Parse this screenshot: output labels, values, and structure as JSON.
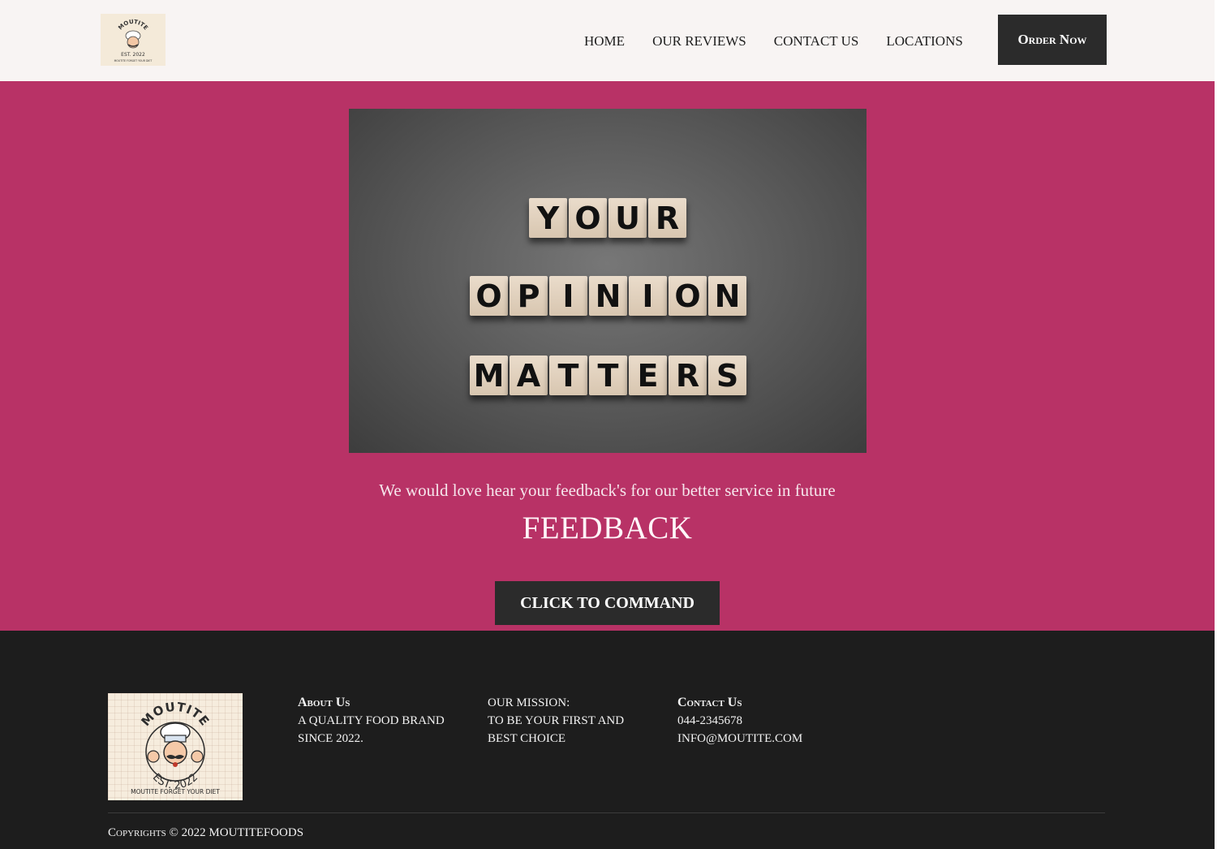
{
  "header": {
    "logo": {
      "alt": "Moutite logo",
      "ring_text": "MOUTITE",
      "est": "EST. 2022",
      "tagline": "MOUTITE FORGET YOUR DIET"
    },
    "nav": [
      "HOME",
      "OUR REVIEWS",
      "CONTACT US",
      "LOCATIONS"
    ],
    "order_button": "Order Now"
  },
  "hero": {
    "image_words": [
      "YOUR",
      "OPINION",
      "MATTERS"
    ],
    "subtitle": "We would love hear your feedback's for our better service in future",
    "title": "FEEDBACK",
    "cta_button": "CLICK TO COMMAND"
  },
  "footer": {
    "logo": {
      "ring_text": "MOUTITE",
      "est": "EST. 2022",
      "tagline": "MOUTITE FORGET YOUR DIET"
    },
    "about": {
      "heading": "About Us",
      "lines": [
        "A QUALITY FOOD BRAND",
        "SINCE 2022."
      ]
    },
    "mission": {
      "heading": "OUR MISSION:",
      "lines": [
        "TO BE YOUR FIRST AND",
        "BEST CHOICE"
      ]
    },
    "contact": {
      "heading": "Contact Us",
      "lines": [
        "044-2345678",
        "INFO@MOUTITE.COM"
      ]
    },
    "copyright": "Copyrights © 2022 MOUTITEFOODS"
  },
  "colors": {
    "header_bg": "#f8f4f3",
    "hero_bg": "#b83266",
    "footer_bg": "#1d1d1d",
    "button_bg": "#2b2b2b"
  }
}
